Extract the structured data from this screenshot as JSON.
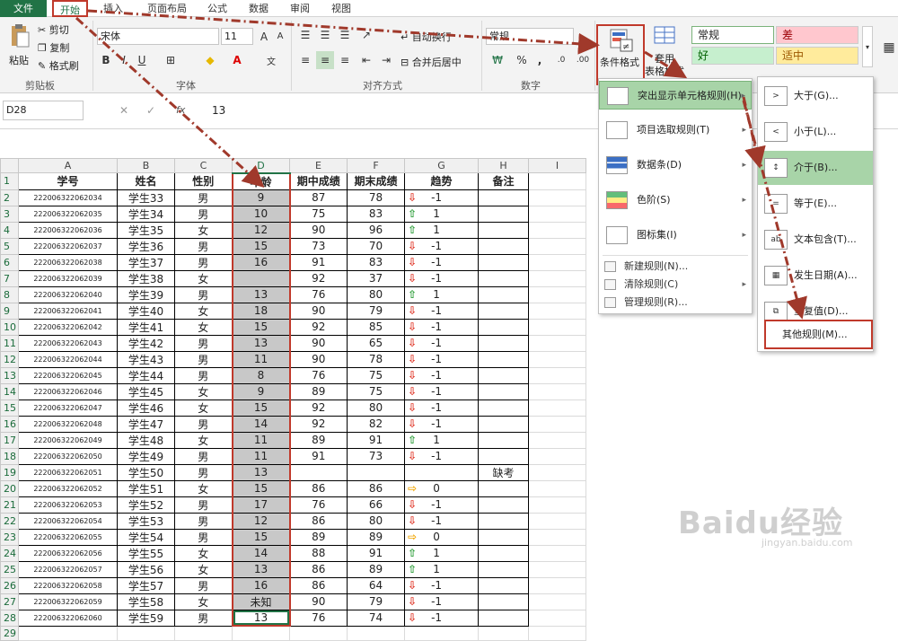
{
  "tabs": [
    "文件",
    "开始",
    "插入",
    "页面布局",
    "公式",
    "数据",
    "审阅",
    "视图"
  ],
  "ribbon": {
    "paste": "粘贴",
    "cut": "剪切",
    "copy": "复制",
    "format_painter": "格式刷",
    "clipboard_group": "剪贴板",
    "font_name": "宋体",
    "font_size": "11",
    "font_group": "字体",
    "wrap_text": "自动换行",
    "merge_center": "合并后居中",
    "align_group": "对齐方式",
    "number_format": "常规",
    "number_group": "数字",
    "conditional_format": "条件格式",
    "table_format_top": "套用",
    "table_format_bottom": "表格格式",
    "styles": {
      "normal": "常规",
      "bad": "差",
      "good": "好",
      "neutral": "适中"
    },
    "percent_glyph": "%",
    "comma_glyph": ","
  },
  "formula_bar": {
    "name_box": "D28",
    "fx": "fx",
    "value": "13"
  },
  "columns": [
    "A",
    "B",
    "C",
    "D",
    "E",
    "F",
    "G",
    "H",
    "I"
  ],
  "headers": [
    "学号",
    "姓名",
    "性别",
    "年龄",
    "期中成绩",
    "期末成绩",
    "趋势",
    "备注"
  ],
  "rows": [
    {
      "n": "2",
      "id": "222006322062034",
      "name": "学生33",
      "sex": "男",
      "age": "9",
      "mid": "87",
      "fin": "78",
      "dir": "down",
      "trend": "-1",
      "note": ""
    },
    {
      "n": "3",
      "id": "222006322062035",
      "name": "学生34",
      "sex": "男",
      "age": "10",
      "mid": "75",
      "fin": "83",
      "dir": "up",
      "trend": "1",
      "note": ""
    },
    {
      "n": "4",
      "id": "222006322062036",
      "name": "学生35",
      "sex": "女",
      "age": "12",
      "mid": "90",
      "fin": "96",
      "dir": "up",
      "trend": "1",
      "note": ""
    },
    {
      "n": "5",
      "id": "222006322062037",
      "name": "学生36",
      "sex": "男",
      "age": "15",
      "mid": "73",
      "fin": "70",
      "dir": "down",
      "trend": "-1",
      "note": ""
    },
    {
      "n": "6",
      "id": "222006322062038",
      "name": "学生37",
      "sex": "男",
      "age": "16",
      "mid": "91",
      "fin": "83",
      "dir": "down",
      "trend": "-1",
      "note": ""
    },
    {
      "n": "7",
      "id": "222006322062039",
      "name": "学生38",
      "sex": "女",
      "age": "",
      "mid": "92",
      "fin": "37",
      "dir": "down",
      "trend": "-1",
      "note": ""
    },
    {
      "n": "8",
      "id": "222006322062040",
      "name": "学生39",
      "sex": "男",
      "age": "13",
      "mid": "76",
      "fin": "80",
      "dir": "up",
      "trend": "1",
      "note": ""
    },
    {
      "n": "9",
      "id": "222006322062041",
      "name": "学生40",
      "sex": "女",
      "age": "18",
      "mid": "90",
      "fin": "79",
      "dir": "down",
      "trend": "-1",
      "note": ""
    },
    {
      "n": "10",
      "id": "222006322062042",
      "name": "学生41",
      "sex": "女",
      "age": "15",
      "mid": "92",
      "fin": "85",
      "dir": "down",
      "trend": "-1",
      "note": ""
    },
    {
      "n": "11",
      "id": "222006322062043",
      "name": "学生42",
      "sex": "男",
      "age": "13",
      "mid": "90",
      "fin": "65",
      "dir": "down",
      "trend": "-1",
      "note": ""
    },
    {
      "n": "12",
      "id": "222006322062044",
      "name": "学生43",
      "sex": "男",
      "age": "11",
      "mid": "90",
      "fin": "78",
      "dir": "down",
      "trend": "-1",
      "note": ""
    },
    {
      "n": "13",
      "id": "222006322062045",
      "name": "学生44",
      "sex": "男",
      "age": "8",
      "mid": "76",
      "fin": "75",
      "dir": "down",
      "trend": "-1",
      "note": ""
    },
    {
      "n": "14",
      "id": "222006322062046",
      "name": "学生45",
      "sex": "女",
      "age": "9",
      "mid": "89",
      "fin": "75",
      "dir": "down",
      "trend": "-1",
      "note": ""
    },
    {
      "n": "15",
      "id": "222006322062047",
      "name": "学生46",
      "sex": "女",
      "age": "15",
      "mid": "92",
      "fin": "80",
      "dir": "down",
      "trend": "-1",
      "note": ""
    },
    {
      "n": "16",
      "id": "222006322062048",
      "name": "学生47",
      "sex": "男",
      "age": "14",
      "mid": "92",
      "fin": "82",
      "dir": "down",
      "trend": "-1",
      "note": ""
    },
    {
      "n": "17",
      "id": "222006322062049",
      "name": "学生48",
      "sex": "女",
      "age": "11",
      "mid": "89",
      "fin": "91",
      "dir": "up",
      "trend": "1",
      "note": ""
    },
    {
      "n": "18",
      "id": "222006322062050",
      "name": "学生49",
      "sex": "男",
      "age": "11",
      "mid": "91",
      "fin": "73",
      "dir": "down",
      "trend": "-1",
      "note": ""
    },
    {
      "n": "19",
      "id": "222006322062051",
      "name": "学生50",
      "sex": "男",
      "age": "13",
      "mid": "",
      "fin": "",
      "dir": "",
      "trend": "",
      "note": "缺考"
    },
    {
      "n": "20",
      "id": "222006322062052",
      "name": "学生51",
      "sex": "女",
      "age": "15",
      "mid": "86",
      "fin": "86",
      "dir": "flat",
      "trend": "0",
      "note": ""
    },
    {
      "n": "21",
      "id": "222006322062053",
      "name": "学生52",
      "sex": "男",
      "age": "17",
      "mid": "76",
      "fin": "66",
      "dir": "down",
      "trend": "-1",
      "note": ""
    },
    {
      "n": "22",
      "id": "222006322062054",
      "name": "学生53",
      "sex": "男",
      "age": "12",
      "mid": "86",
      "fin": "80",
      "dir": "down",
      "trend": "-1",
      "note": ""
    },
    {
      "n": "23",
      "id": "222006322062055",
      "name": "学生54",
      "sex": "男",
      "age": "15",
      "mid": "89",
      "fin": "89",
      "dir": "flat",
      "trend": "0",
      "note": ""
    },
    {
      "n": "24",
      "id": "222006322062056",
      "name": "学生55",
      "sex": "女",
      "age": "14",
      "mid": "88",
      "fin": "91",
      "dir": "up",
      "trend": "1",
      "note": ""
    },
    {
      "n": "25",
      "id": "222006322062057",
      "name": "学生56",
      "sex": "女",
      "age": "13",
      "mid": "86",
      "fin": "89",
      "dir": "up",
      "trend": "1",
      "note": ""
    },
    {
      "n": "26",
      "id": "222006322062058",
      "name": "学生57",
      "sex": "男",
      "age": "16",
      "mid": "86",
      "fin": "64",
      "dir": "down",
      "trend": "-1",
      "note": ""
    },
    {
      "n": "27",
      "id": "222006322062059",
      "name": "学生58",
      "sex": "女",
      "age": "未知",
      "mid": "90",
      "fin": "79",
      "dir": "down",
      "trend": "-1",
      "note": ""
    },
    {
      "n": "28",
      "id": "222006322062060",
      "name": "学生59",
      "sex": "男",
      "age": "13",
      "mid": "76",
      "fin": "74",
      "dir": "down",
      "trend": "-1",
      "note": ""
    }
  ],
  "last_row": "29",
  "arrow_glyphs": {
    "up": "⇧",
    "down": "⇩",
    "flat": "⇨"
  },
  "menu": {
    "highlight_rules": "突出显示单元格规则(H)",
    "top_bottom": "项目选取规则(T)",
    "data_bars": "数据条(D)",
    "color_scales": "色阶(S)",
    "icon_sets": "图标集(I)",
    "new_rule": "新建规则(N)...",
    "clear_rules": "清除规则(C)",
    "manage_rules": "管理规则(R)..."
  },
  "submenu": {
    "greater": "大于(G)...",
    "less": "小于(L)...",
    "between": "介于(B)...",
    "equal": "等于(E)...",
    "text_contains": "文本包含(T)...",
    "date_occurring": "发生日期(A)...",
    "duplicate": "重复值(D)...",
    "more_rules": "其他规则(M)..."
  },
  "colors": {
    "accent": "#217346",
    "highlight": "#a8d4a8",
    "red_mark": "#c0392b",
    "bad_bg": "#ffc7ce",
    "good_bg": "#c6efce",
    "neutral_bg": "#ffeb9c"
  },
  "watermark": {
    "main": "Baidu经验",
    "sub": "jingyan.baidu.com"
  }
}
